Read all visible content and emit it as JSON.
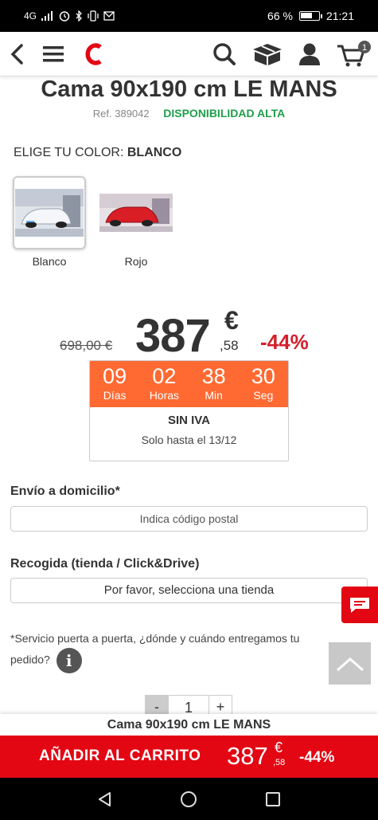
{
  "status_bar": {
    "network": "4G",
    "battery_percent": "66 %",
    "battery_level": 0.66,
    "time": "21:21"
  },
  "header": {
    "icons": [
      "back-icon",
      "menu-icon",
      "brand-logo",
      "search-icon",
      "package-icon",
      "user-icon",
      "cart-icon"
    ],
    "cart_count": "1",
    "brand_color": "#e30613"
  },
  "product": {
    "title": "Cama 90x190 cm LE MANS",
    "ref": "Ref. 389042",
    "availability": "DISPONIBILIDAD ALTA"
  },
  "color_selector": {
    "label": "ELIGE TU COLOR: ",
    "selected": "BLANCO",
    "options": [
      {
        "label": "Blanco",
        "selected": true
      },
      {
        "label": "Rojo",
        "selected": false
      }
    ]
  },
  "price": {
    "old": "698,00 €",
    "integer": "387",
    "currency": "€",
    "decimals": ",58",
    "discount": "-44%"
  },
  "countdown": {
    "days": "09",
    "days_label": "Días",
    "hours": "02",
    "hours_label": "Horas",
    "minutes": "38",
    "minutes_label": "Min",
    "seconds": "30",
    "seconds_label": "Seg",
    "tax_note": "SIN IVA",
    "valid_until": "Solo hasta el 13/12",
    "accent": "#ff6a33"
  },
  "delivery": {
    "home_label": "Envío a domicilio*",
    "postal_placeholder": "Indica código postal",
    "pickup_label": "Recogida (tienda / Click&Drive)",
    "store_select": "Por favor, selecciona una tienda",
    "service_note": "*Servicio puerta a puerta, ¿dónde y cuándo entregamos tu pedido?"
  },
  "quantity": {
    "minus": "-",
    "value": "1",
    "plus": "+"
  },
  "sticky": {
    "product_name": "Cama 90x190 cm LE MANS",
    "add_to_cart": "AÑADIR AL CARRITO",
    "price_integer": "387",
    "price_currency": "€",
    "price_decimals": ",58",
    "discount": "-44%"
  }
}
